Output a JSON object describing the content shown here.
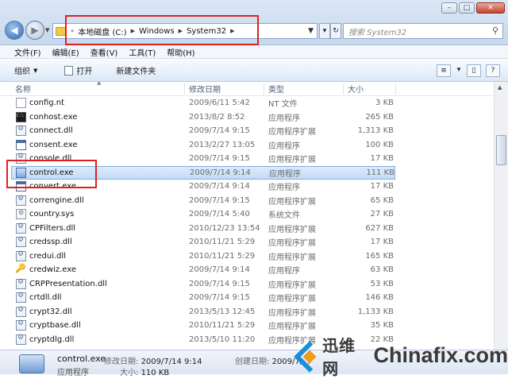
{
  "address_bar": {
    "breadcrumbs": [
      "本地磁盘 (C:)",
      "Windows",
      "System32"
    ],
    "search_placeholder": "搜索 System32"
  },
  "menu": [
    "文件(F)",
    "编辑(E)",
    "查看(V)",
    "工具(T)",
    "帮助(H)"
  ],
  "command_bar": {
    "organize": "组织",
    "open": "打开",
    "new_folder": "新建文件夹"
  },
  "columns": {
    "name": "名称",
    "date": "修改日期",
    "type": "类型",
    "size": "大小"
  },
  "files": [
    {
      "name": "config.nt",
      "date": "2009/6/11 5:42",
      "type": "NT 文件",
      "size": "3 KB",
      "icon": "page-icon"
    },
    {
      "name": "conhost.exe",
      "date": "2013/8/2 8:52",
      "type": "应用程序",
      "size": "265 KB",
      "icon": "console-icon"
    },
    {
      "name": "connect.dll",
      "date": "2009/7/14 9:15",
      "type": "应用程序扩展",
      "size": "1,313 KB",
      "icon": "dll-icon"
    },
    {
      "name": "consent.exe",
      "date": "2013/2/27 13:05",
      "type": "应用程序",
      "size": "100 KB",
      "icon": "window-icon"
    },
    {
      "name": "console.dll",
      "date": "2009/7/14 9:15",
      "type": "应用程序扩展",
      "size": "17 KB",
      "icon": "dll-icon"
    },
    {
      "name": "control.exe",
      "date": "2009/7/14 9:14",
      "type": "应用程序",
      "size": "111 KB",
      "icon": "control-panel-icon",
      "selected": true
    },
    {
      "name": "convert.exe",
      "date": "2009/7/14 9:14",
      "type": "应用程序",
      "size": "17 KB",
      "icon": "window-icon"
    },
    {
      "name": "correngine.dll",
      "date": "2009/7/14 9:15",
      "type": "应用程序扩展",
      "size": "65 KB",
      "icon": "dll-icon"
    },
    {
      "name": "country.sys",
      "date": "2009/7/14 5:40",
      "type": "系统文件",
      "size": "27 KB",
      "icon": "sys-file-icon"
    },
    {
      "name": "CPFilters.dll",
      "date": "2010/12/23 13:54",
      "type": "应用程序扩展",
      "size": "627 KB",
      "icon": "dll-icon"
    },
    {
      "name": "credssp.dll",
      "date": "2010/11/21 5:29",
      "type": "应用程序扩展",
      "size": "17 KB",
      "icon": "dll-icon"
    },
    {
      "name": "credui.dll",
      "date": "2010/11/21 5:29",
      "type": "应用程序扩展",
      "size": "165 KB",
      "icon": "dll-icon"
    },
    {
      "name": "credwiz.exe",
      "date": "2009/7/14 9:14",
      "type": "应用程序",
      "size": "63 KB",
      "icon": "key-icon"
    },
    {
      "name": "CRPPresentation.dll",
      "date": "2009/7/14 9:15",
      "type": "应用程序扩展",
      "size": "53 KB",
      "icon": "dll-icon"
    },
    {
      "name": "crtdll.dll",
      "date": "2009/7/14 9:15",
      "type": "应用程序扩展",
      "size": "146 KB",
      "icon": "dll-icon"
    },
    {
      "name": "crypt32.dll",
      "date": "2013/5/13 12:45",
      "type": "应用程序扩展",
      "size": "1,133 KB",
      "icon": "dll-icon"
    },
    {
      "name": "cryptbase.dll",
      "date": "2010/11/21 5:29",
      "type": "应用程序扩展",
      "size": "35 KB",
      "icon": "dll-icon"
    },
    {
      "name": "cryptdlg.dll",
      "date": "2013/5/10 11:20",
      "type": "应用程序扩展",
      "size": "22 KB",
      "icon": "dll-icon"
    }
  ],
  "details": {
    "name": "control.exe",
    "type": "应用程序",
    "modified_label": "修改日期:",
    "modified": "2009/7/14 9:14",
    "size_label": "大小:",
    "size": "110 KB",
    "created_label": "创建日期:",
    "created": "2009/7/..."
  },
  "watermark": {
    "cn": "迅维网",
    "en": "Chinafix.com"
  },
  "colors": {
    "highlight_box": "#e02020",
    "selection": "#c3dcf6"
  }
}
